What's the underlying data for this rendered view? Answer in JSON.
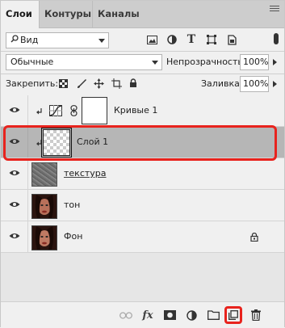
{
  "tabs": [
    {
      "label": "Слои",
      "active": true
    },
    {
      "label": "Контуры",
      "active": false
    },
    {
      "label": "Каналы",
      "active": false
    }
  ],
  "filter": {
    "selected": "Вид"
  },
  "blend": {
    "mode": "Обычные",
    "opacity_label": "Непрозрачность:",
    "opacity_value": "100%"
  },
  "lock": {
    "label": "Закрепить:",
    "fill_label": "Заливка:",
    "fill_value": "100%"
  },
  "layers": [
    {
      "name": "Кривые 1",
      "type": "adjustment",
      "clipped": true,
      "visible": true,
      "selected": false
    },
    {
      "name": "Слой 1",
      "type": "transparent",
      "clipped": true,
      "visible": true,
      "selected": true
    },
    {
      "name": "текстура",
      "type": "texture",
      "clipped": false,
      "visible": true,
      "selected": false
    },
    {
      "name": "тон",
      "type": "photo",
      "clipped": false,
      "visible": true,
      "selected": false
    },
    {
      "name": "Фон",
      "type": "photo",
      "clipped": false,
      "visible": true,
      "selected": false,
      "locked": true
    }
  ],
  "colors": {
    "highlight": "#e8231d",
    "selected_row": "#b6b6b6",
    "panel": "#f0f0f0"
  },
  "bottom_icons": [
    "link-layers-icon",
    "fx-icon",
    "add-mask-icon",
    "adjustment-layer-icon",
    "new-group-icon",
    "new-layer-icon",
    "delete-layer-icon"
  ]
}
